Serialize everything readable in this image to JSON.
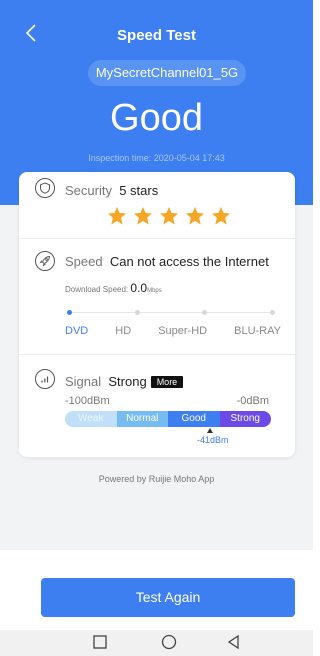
{
  "header": {
    "title": "Speed Test",
    "ssid": "MySecretChannel01_5G",
    "rating": "Good",
    "inspection_label": "Inspection time:",
    "inspection_time": "2020-05-04 17:43"
  },
  "security": {
    "label": "Security",
    "value": "5 stars",
    "stars": 5
  },
  "speed": {
    "label": "Speed",
    "value": "Can not access the Internet",
    "download_label": "Download Speed:",
    "download_value": "0.0",
    "download_unit": "Mbps",
    "tiers": [
      "DVD",
      "HD",
      "Super-HD",
      "BLU-RAY"
    ],
    "active_tier": "DVD"
  },
  "signal": {
    "label": "Signal",
    "value": "Strong",
    "more_label": "More",
    "min_label": "-100dBm",
    "max_label": "-0dBm",
    "segments": [
      "Weak",
      "Normal",
      "Good",
      "Strong"
    ],
    "current": "-41dBm"
  },
  "footer": {
    "powered_by": "Powered by Ruijie Moho App",
    "button_label": "Test Again"
  },
  "colors": {
    "accent": "#3d7ff0",
    "star": "#f5a623",
    "strong": "#6b4ae6"
  },
  "icons": {
    "back": "chevron-left-icon",
    "security": "shield-icon",
    "speed": "rocket-icon",
    "signal": "signal-bars-icon",
    "nav": [
      "square-recents-icon",
      "circle-home-icon",
      "triangle-back-icon"
    ]
  }
}
